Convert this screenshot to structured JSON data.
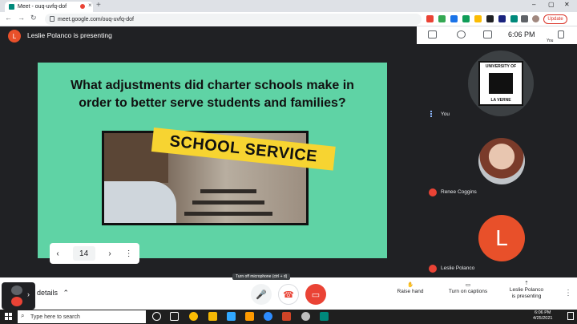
{
  "browser": {
    "tab_title": "Meet - ouq-uvfq-dof",
    "new_tab_symbol": "+",
    "url": "meet.google.com/ouq-uvfq-dof",
    "update_label": "Update",
    "window_controls": [
      "–",
      "▢",
      "✕"
    ]
  },
  "meet": {
    "presenter_initial": "L",
    "presenter_text": "Leslie Polanco is presenting",
    "slide": {
      "title_line1": "What adjustments did charter schools make in",
      "title_line2": "order to better serve students and families?",
      "banner_text": "SCHOOL SERVICE",
      "page_number": "14",
      "prev_symbol": "‹",
      "next_symbol": "›",
      "more_symbol": "⋮"
    },
    "top_panel": {
      "time": "6:06 PM",
      "you_label": "You"
    },
    "participants": [
      {
        "name": "You",
        "logo_top": "UNIVERSITY OF",
        "logo_bottom": "LA VERNE"
      },
      {
        "name": "Renee Coggins"
      },
      {
        "name": "Leslie Polanco",
        "initial": "L"
      }
    ],
    "controls": {
      "details_label": "details",
      "tooltip": "Turn off microphone (ctrl + d)",
      "raise_hand": "Raise hand",
      "captions": "Turn on captions",
      "presenting_line1": "Leslie Polanco",
      "presenting_line2": "is presenting"
    }
  },
  "taskbar": {
    "search_placeholder": "Type here to search",
    "time": "6:06 PM",
    "date": "4/25/2021"
  },
  "colors": {
    "slide_bg": "#5fd3a5",
    "banner": "#f7d431",
    "accent_red": "#ea4335",
    "avatar_orange": "#e8502a"
  }
}
